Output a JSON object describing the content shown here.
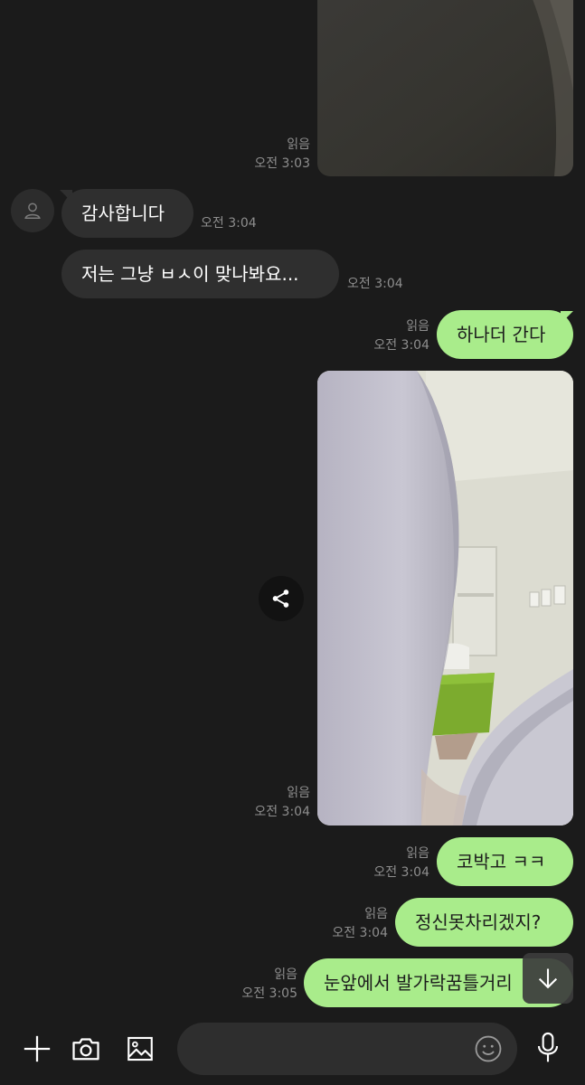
{
  "messages": [
    {
      "type": "image",
      "side": "out",
      "read": "읽음",
      "time": "오전 3:03",
      "image": "dim-gray-photo"
    },
    {
      "type": "text",
      "side": "in",
      "text": "감사합니다",
      "time": "오전 3:04"
    },
    {
      "type": "text",
      "side": "in",
      "text": "저는 그냥 ㅂㅅ이 맞나봐요...",
      "time": "오전 3:04"
    },
    {
      "type": "text",
      "side": "out",
      "text": "하나더 간다",
      "read": "읽음",
      "time": "오전 3:04"
    },
    {
      "type": "image",
      "side": "out",
      "read": "읽음",
      "time": "오전 3:04",
      "image": "sock-foot-room-photo"
    },
    {
      "type": "text",
      "side": "out",
      "text": "코박고 ㅋㅋ",
      "read": "읽음",
      "time": "오전 3:04"
    },
    {
      "type": "text",
      "side": "out",
      "text": "정신못차리겠지?",
      "read": "읽음",
      "time": "오전 3:04"
    },
    {
      "type": "text",
      "side": "out",
      "text": "눈앞에서 발가락꿈틀거리",
      "read": "읽음",
      "time": "오전 3:05"
    }
  ],
  "icons": {
    "avatar": "person-icon",
    "share": "share-icon",
    "scroll": "arrow-down-icon",
    "add": "plus-icon",
    "camera": "camera-icon",
    "gallery": "image-icon",
    "emoji": "emoji-icon",
    "mic": "microphone-icon"
  },
  "composer": {
    "placeholder": ""
  },
  "colors": {
    "background": "#1b1b1b",
    "incoming_bubble": "#2f2f2f",
    "outgoing_bubble": "#a9ec8b",
    "meta_text": "#8e8e8e"
  }
}
